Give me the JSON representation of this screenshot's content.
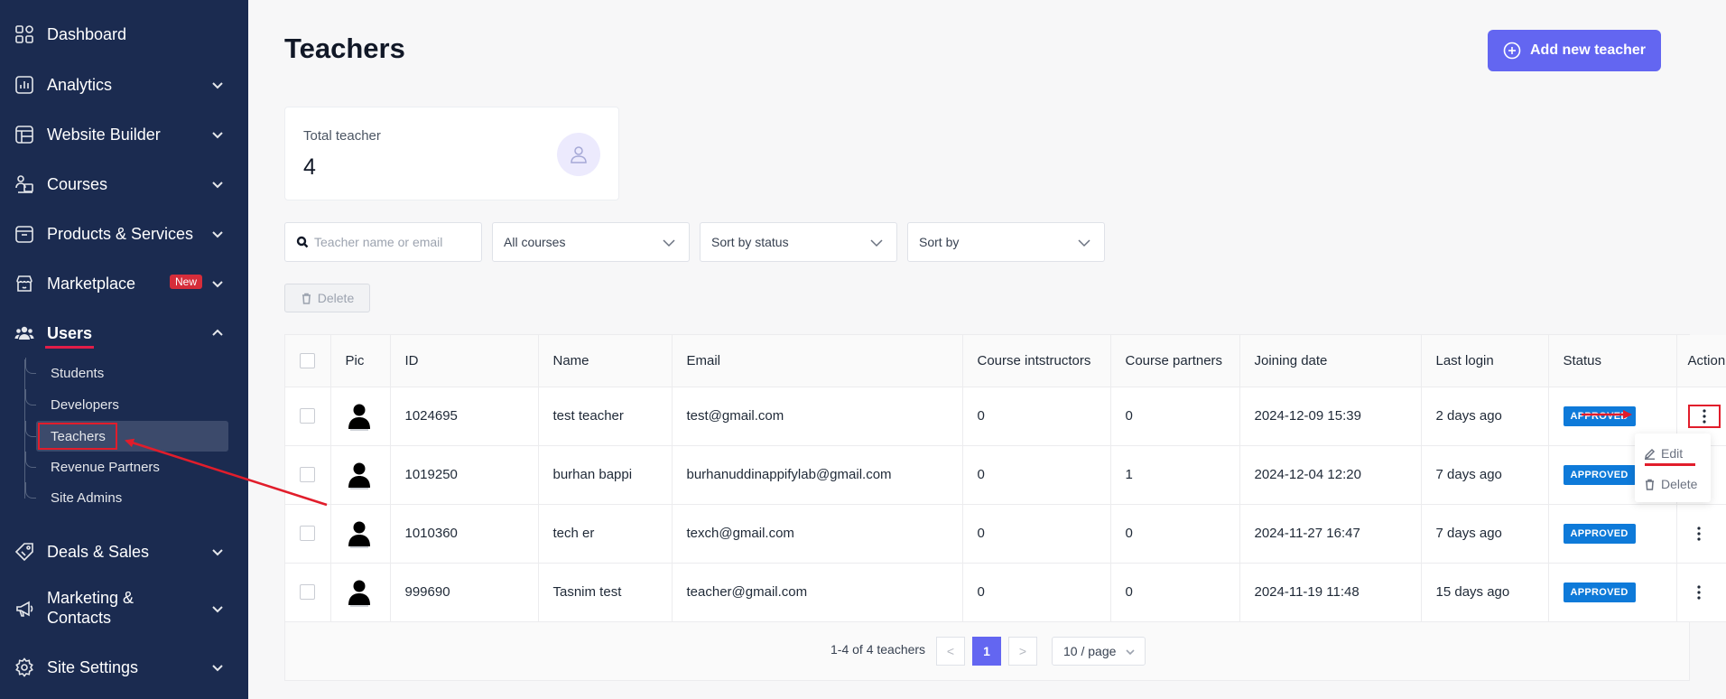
{
  "sidebar": {
    "items": [
      {
        "label": "Dashboard",
        "icon": "dashboard-icon"
      },
      {
        "label": "Analytics",
        "icon": "analytics-icon"
      },
      {
        "label": "Website Builder",
        "icon": "website-builder-icon"
      },
      {
        "label": "Courses",
        "icon": "courses-icon"
      },
      {
        "label": "Products & Services",
        "icon": "products-icon"
      },
      {
        "label": "Marketplace",
        "icon": "marketplace-icon",
        "badge": "New"
      },
      {
        "label": "Users",
        "icon": "users-icon"
      },
      {
        "label": "Deals & Sales",
        "icon": "deals-icon"
      },
      {
        "label": "Marketing &",
        "label2": "Contacts",
        "icon": "marketing-icon"
      },
      {
        "label": "Site Settings",
        "icon": "settings-icon"
      }
    ],
    "users_sub": [
      "Students",
      "Developers",
      "Teachers",
      "Revenue Partners",
      "Site Admins"
    ],
    "active_sub": "Teachers"
  },
  "header": {
    "title": "Teachers",
    "add_button": "Add new teacher"
  },
  "stat": {
    "label": "Total teacher",
    "value": "4"
  },
  "filters": {
    "search_placeholder": "Teacher name or email",
    "courses": "All courses",
    "status": "Sort by status",
    "sort": "Sort by"
  },
  "delete_button": "Delete",
  "table": {
    "columns": [
      "Pic",
      "ID",
      "Name",
      "Email",
      "Course intstructors",
      "Course partners",
      "Joining date",
      "Last login",
      "Status",
      "Action"
    ],
    "rows": [
      {
        "id": "1024695",
        "name": "test teacher",
        "email": "test@gmail.com",
        "instructors": "0",
        "partners": "0",
        "joined": "2024-12-09 15:39",
        "last_login": "2 days ago",
        "status": "APPROVED"
      },
      {
        "id": "1019250",
        "name": "burhan bappi",
        "email": "burhanuddinappifylab@gmail.com",
        "instructors": "0",
        "partners": "1",
        "joined": "2024-12-04 12:20",
        "last_login": "7 days ago",
        "status": "APPROVED"
      },
      {
        "id": "1010360",
        "name": "tech er",
        "email": "texch@gmail.com",
        "instructors": "0",
        "partners": "0",
        "joined": "2024-11-27 16:47",
        "last_login": "7 days ago",
        "status": "APPROVED"
      },
      {
        "id": "999690",
        "name": "Tasnim test",
        "email": "teacher@gmail.com",
        "instructors": "0",
        "partners": "0",
        "joined": "2024-11-19 11:48",
        "last_login": "15 days ago",
        "status": "APPROVED"
      }
    ]
  },
  "pagination": {
    "info": "1-4 of 4 teachers",
    "current": "1",
    "prev": "<",
    "next": ">",
    "page_size": "10 / page"
  },
  "action_menu": {
    "edit": "Edit",
    "delete": "Delete"
  },
  "colors": {
    "sidebar_bg": "#1b2b50",
    "accent": "#6366f1",
    "status_approved": "#0e7ad9",
    "annotation_red": "#e11d2b"
  }
}
